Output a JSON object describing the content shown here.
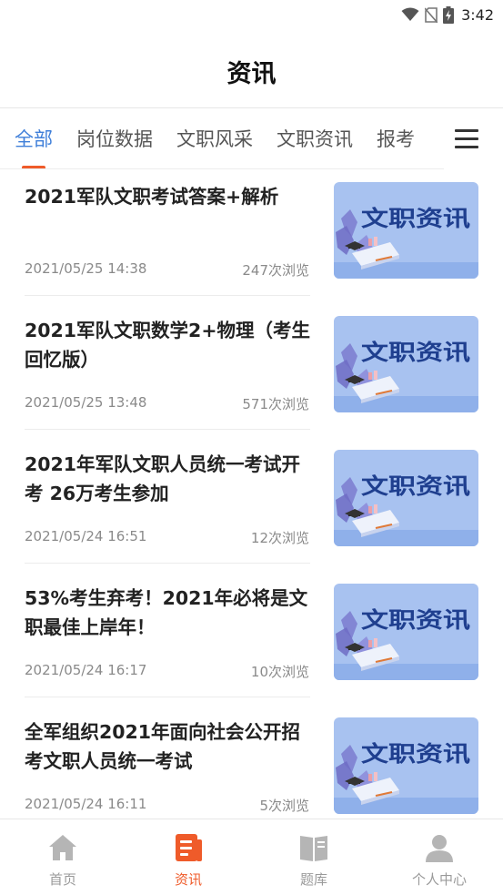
{
  "status_bar": {
    "time": "3:42"
  },
  "header": {
    "title": "资讯"
  },
  "tabs": [
    {
      "label": "全部",
      "active": true
    },
    {
      "label": "岗位数据",
      "active": false
    },
    {
      "label": "文职风采",
      "active": false
    },
    {
      "label": "文职资讯",
      "active": false
    },
    {
      "label": "报考",
      "active": false
    }
  ],
  "articles": [
    {
      "title": "2021军队文职考试答案+解析",
      "date": "2021/05/25 14:38",
      "views": "247次浏览",
      "thumb_text": "文职资讯"
    },
    {
      "title": "2021军队文职数学2+物理（考生回忆版）",
      "date": "2021/05/25 13:48",
      "views": "571次浏览",
      "thumb_text": "文职资讯"
    },
    {
      "title": "2021年军队文职人员统一考试开考 26万考生参加",
      "date": "2021/05/24 16:51",
      "views": "12次浏览",
      "thumb_text": "文职资讯"
    },
    {
      "title": "53%考生弃考！2021年必将是文职最佳上岸年！",
      "date": "2021/05/24 16:17",
      "views": "10次浏览",
      "thumb_text": "文职资讯"
    },
    {
      "title": "全军组织2021年面向社会公开招考文职人员统一考试",
      "date": "2021/05/24 16:11",
      "views": "5次浏览",
      "thumb_text": "文职资讯"
    }
  ],
  "bottom_nav": [
    {
      "label": "首页",
      "icon": "home-icon",
      "active": false
    },
    {
      "label": "资讯",
      "icon": "news-icon",
      "active": true
    },
    {
      "label": "题库",
      "icon": "question-bank-icon",
      "active": false
    },
    {
      "label": "个人中心",
      "icon": "profile-icon",
      "active": false
    }
  ],
  "colors": {
    "accent": "#3f7fd9",
    "indicator": "#ef5b2a",
    "thumb_bg": "#a8c2f0",
    "thumb_text": "#1f3f8f"
  }
}
